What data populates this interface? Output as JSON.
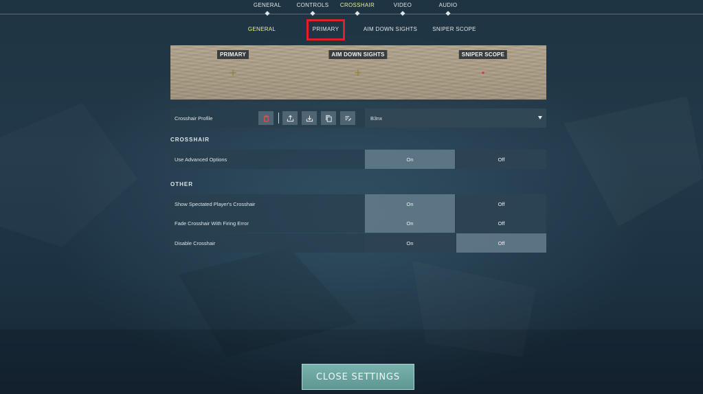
{
  "top_nav": {
    "items": [
      {
        "label": "GENERAL"
      },
      {
        "label": "CONTROLS"
      },
      {
        "label": "CROSSHAIR"
      },
      {
        "label": "VIDEO"
      },
      {
        "label": "AUDIO"
      }
    ],
    "active": "CROSSHAIR"
  },
  "sub_tabs": {
    "items": [
      {
        "label": "GENERAL"
      },
      {
        "label": "PRIMARY"
      },
      {
        "label": "AIM DOWN SIGHTS"
      },
      {
        "label": "SNIPER SCOPE"
      }
    ],
    "active": "GENERAL",
    "highlighted": "PRIMARY"
  },
  "preview": {
    "labels": {
      "primary": "PRIMARY",
      "ads": "AIM DOWN SIGHTS",
      "sniper": "SNIPER SCOPE"
    }
  },
  "profile": {
    "label": "Crosshair Profile",
    "value": "B3nx",
    "icons": [
      "trash-icon",
      "upload-icon",
      "download-icon",
      "copy-icon",
      "rename-icon"
    ]
  },
  "sections": {
    "crosshair": {
      "title": "CROSSHAIR",
      "rows": [
        {
          "label": "Use Advanced Options",
          "on": "On",
          "off": "Off",
          "selected": "On"
        }
      ]
    },
    "other": {
      "title": "OTHER",
      "rows": [
        {
          "label": "Show Spectated Player's Crosshair",
          "on": "On",
          "off": "Off",
          "selected": "On"
        },
        {
          "label": "Fade Crosshair With Firing Error",
          "on": "On",
          "off": "Off",
          "selected": "On"
        },
        {
          "label": "Disable Crosshair",
          "on": "On",
          "off": "Off",
          "selected": "Off"
        }
      ]
    }
  },
  "close_button": {
    "label": "CLOSE SETTINGS"
  },
  "colors": {
    "accent_active": "#e9f0a0",
    "highlight_box": "#e0202a",
    "close_button": "#6fa7a2",
    "trash_icon": "#e05050"
  }
}
